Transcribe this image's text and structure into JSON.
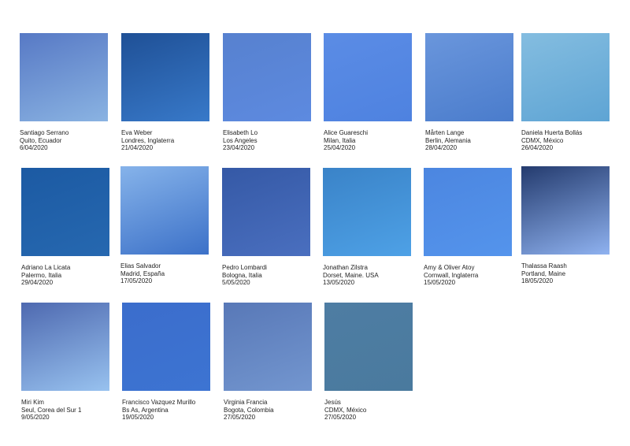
{
  "entries": [
    {
      "name": "Santiago Serrano",
      "place": "Quito, Ecuador",
      "date": "6/04/2020",
      "color_top": "#5779c5",
      "color_bottom": "#8ab3e2"
    },
    {
      "name": "Eva Weber",
      "place": "Londres, Inglaterra",
      "date": "21/04/2020",
      "color_top": "#1f5096",
      "color_bottom": "#3879c9"
    },
    {
      "name": "Elisabeth Lo",
      "place": "Los Angeles",
      "date": "23/04/2020",
      "color_top": "#5781cf",
      "color_bottom": "#5d8ae0"
    },
    {
      "name": "Alice Guareschi",
      "place": "Milan, Italia",
      "date": "25/04/2020",
      "color_top": "#5b8ce5",
      "color_bottom": "#4e82e0"
    },
    {
      "name": "Mårten Lange",
      "place": "Berlin, Alemania",
      "date": "28/04/2020",
      "color_top": "#6a96dc",
      "color_bottom": "#4a7ccc"
    },
    {
      "name": "Daniela Huerta Bollás",
      "place": "CDMX, México",
      "date": "26/04/2020",
      "color_top": "#84bde0",
      "color_bottom": "#5ea4d4"
    },
    {
      "name": "Adriano La Licata",
      "place": "Palermo, Italia",
      "date": "29/04/2020",
      "color_top": "#1c5aa3",
      "color_bottom": "#2668b0"
    },
    {
      "name": "Elias Salvador",
      "place": "Madrid, España",
      "date": "17/05/2020",
      "color_top": "#86b3ea",
      "color_bottom": "#3c71c8"
    },
    {
      "name": "Pedro Lombardi",
      "place": "Bologna, Italia",
      "date": "5/05/2020",
      "color_top": "#3559a6",
      "color_bottom": "#4a6fbf"
    },
    {
      "name": "Jonathan Zilstra",
      "place": "Dorset, Maine. USA",
      "date": "13/05/2020",
      "color_top": "#3a83c8",
      "color_bottom": "#4ea1e6"
    },
    {
      "name": "Amy & Oliver Atoy",
      "place": "Cornwall, Inglaterra",
      "date": "15/05/2020",
      "color_top": "#4c86e0",
      "color_bottom": "#5494ec"
    },
    {
      "name": "Thalassa Raash",
      "place": "Portland, Maine",
      "date": "18/05/2020",
      "color_top": "#243b6e",
      "color_bottom": "#8fb2f0"
    },
    {
      "name": "Miri Kim",
      "place": "Seul, Corea del Sur 1",
      "date": "9/05/2020",
      "color_top": "#4e69b0",
      "color_bottom": "#98c2ef"
    },
    {
      "name": "Francisco Vazquez Murillo",
      "place": "Bs As, Argentina",
      "date": "19/05/2020",
      "color_top": "#3b6dcc",
      "color_bottom": "#3d74d2"
    },
    {
      "name": "Virginia Francia",
      "place": "Bogota, Colombia",
      "date": "27/05/2020",
      "color_top": "#5878b7",
      "color_bottom": "#7396cf"
    },
    {
      "name": "Jesús",
      "place": "CDMX, México",
      "date": "27/05/2020",
      "color_top": "#4e7da3",
      "color_bottom": "#4a7a9e"
    }
  ]
}
